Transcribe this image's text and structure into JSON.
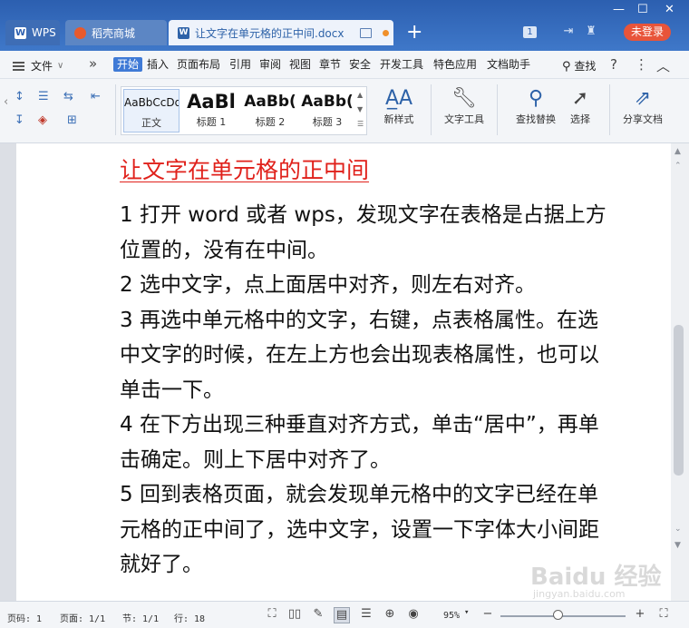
{
  "tabs": {
    "wps": "WPS",
    "mall": "稻壳商城",
    "doc": "让文字在单元格的正中间.docx",
    "new_tab_icon": "plus-icon"
  },
  "titlebar": {
    "page_count": "1",
    "login_button": "未登录",
    "minimize": "—",
    "maximize": "☐",
    "close": "✕"
  },
  "menu": {
    "file": "文件",
    "items": [
      "开始",
      "插入",
      "页面布局",
      "引用",
      "审阅",
      "视图",
      "章节",
      "安全",
      "开发工具",
      "特色应用",
      "文档助手"
    ],
    "find": "查找",
    "help": "?",
    "more": "⋮",
    "collapse": "︿"
  },
  "ribbon": {
    "styles": [
      {
        "sample": "AaBbCcDd",
        "label": "正文"
      },
      {
        "sample": "AaBl",
        "label": "标题 1"
      },
      {
        "sample": "AaBb(",
        "label": "标题 2"
      },
      {
        "sample": "AaBb(",
        "label": "标题 3"
      }
    ],
    "new_style": "新样式",
    "text_tool": "文字工具",
    "find_replace": "查找替换",
    "select": "选择",
    "share": "分享文档"
  },
  "document": {
    "title": "让文字在单元格的正中间",
    "paragraphs": [
      "1 打开 word 或者 wps，发现文字在表格是占据上方位置的，没有在中间。",
      "2 选中文字，点上面居中对齐，则左右对齐。",
      "3 再选中单元格中的文字，右键，点表格属性。在选中文字的时候，在左上方也会出现表格属性，也可以单击一下。",
      "4 在下方出现三种垂直对齐方式，单击“居中”，再单击确定。则上下居中对齐了。",
      "5 回到表格页面，就会发现单元格中的文字已经在单元格的正中间了，选中文字，设置一下字体大小间距就好了。"
    ],
    "watermark": "Baidu 经验",
    "watermark_url": "jingyan.baidu.com"
  },
  "status": {
    "page_code": "页码: 1",
    "page": "页面: 1/1",
    "section": "节: 1/1",
    "row": "行: 18",
    "zoom": "95%",
    "zoom_minus": "−",
    "zoom_plus": "+"
  },
  "colors": {
    "title_bar": "#2c5fb0",
    "accent": "#3f7ad6",
    "doc_title": "#e0211b",
    "login": "#e8543a"
  }
}
